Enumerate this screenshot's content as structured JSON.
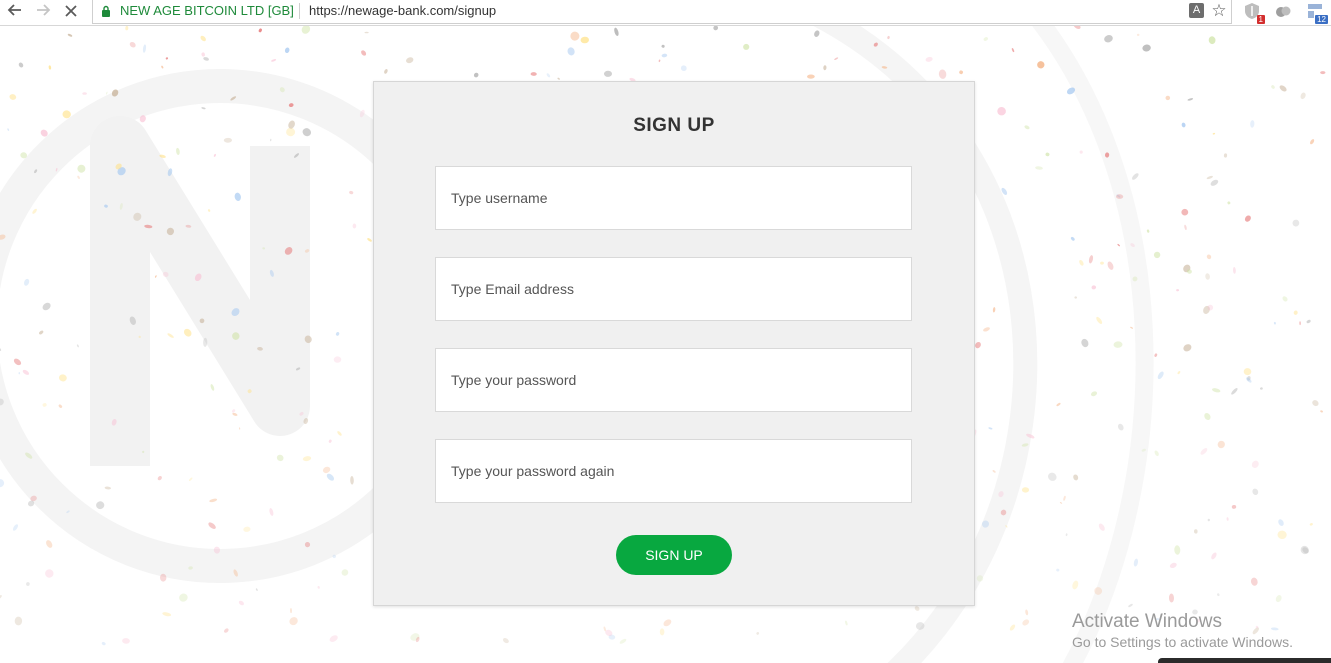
{
  "browser": {
    "ev_name": "NEW AGE BITCOIN LTD [GB]",
    "url": "https://newage-bank.com/signup",
    "back_icon": "arrow-left-icon",
    "forward_icon": "arrow-right-icon",
    "stop_icon": "close-icon",
    "extensions": [
      {
        "icon": "shield-extension-icon",
        "badge": "1",
        "badge_color": "#d32f2f"
      },
      {
        "icon": "cloud-extension-icon",
        "badge": ""
      },
      {
        "icon": "grid-extension-icon",
        "badge": "12",
        "badge_color": "#3b6fc4"
      }
    ]
  },
  "signup": {
    "title": "SIGN UP",
    "username_placeholder": "Type username",
    "email_placeholder": "Type Email address",
    "password_placeholder": "Type your password",
    "password_again_placeholder": "Type your password again",
    "submit_label": "SIGN UP"
  },
  "watermark": {
    "title": "Activate Windows",
    "subtitle": "Go to Settings to activate Windows."
  },
  "colors": {
    "accent": "#08a840",
    "card_bg": "#f0f0f0",
    "ev_green": "#1e8a3a"
  }
}
